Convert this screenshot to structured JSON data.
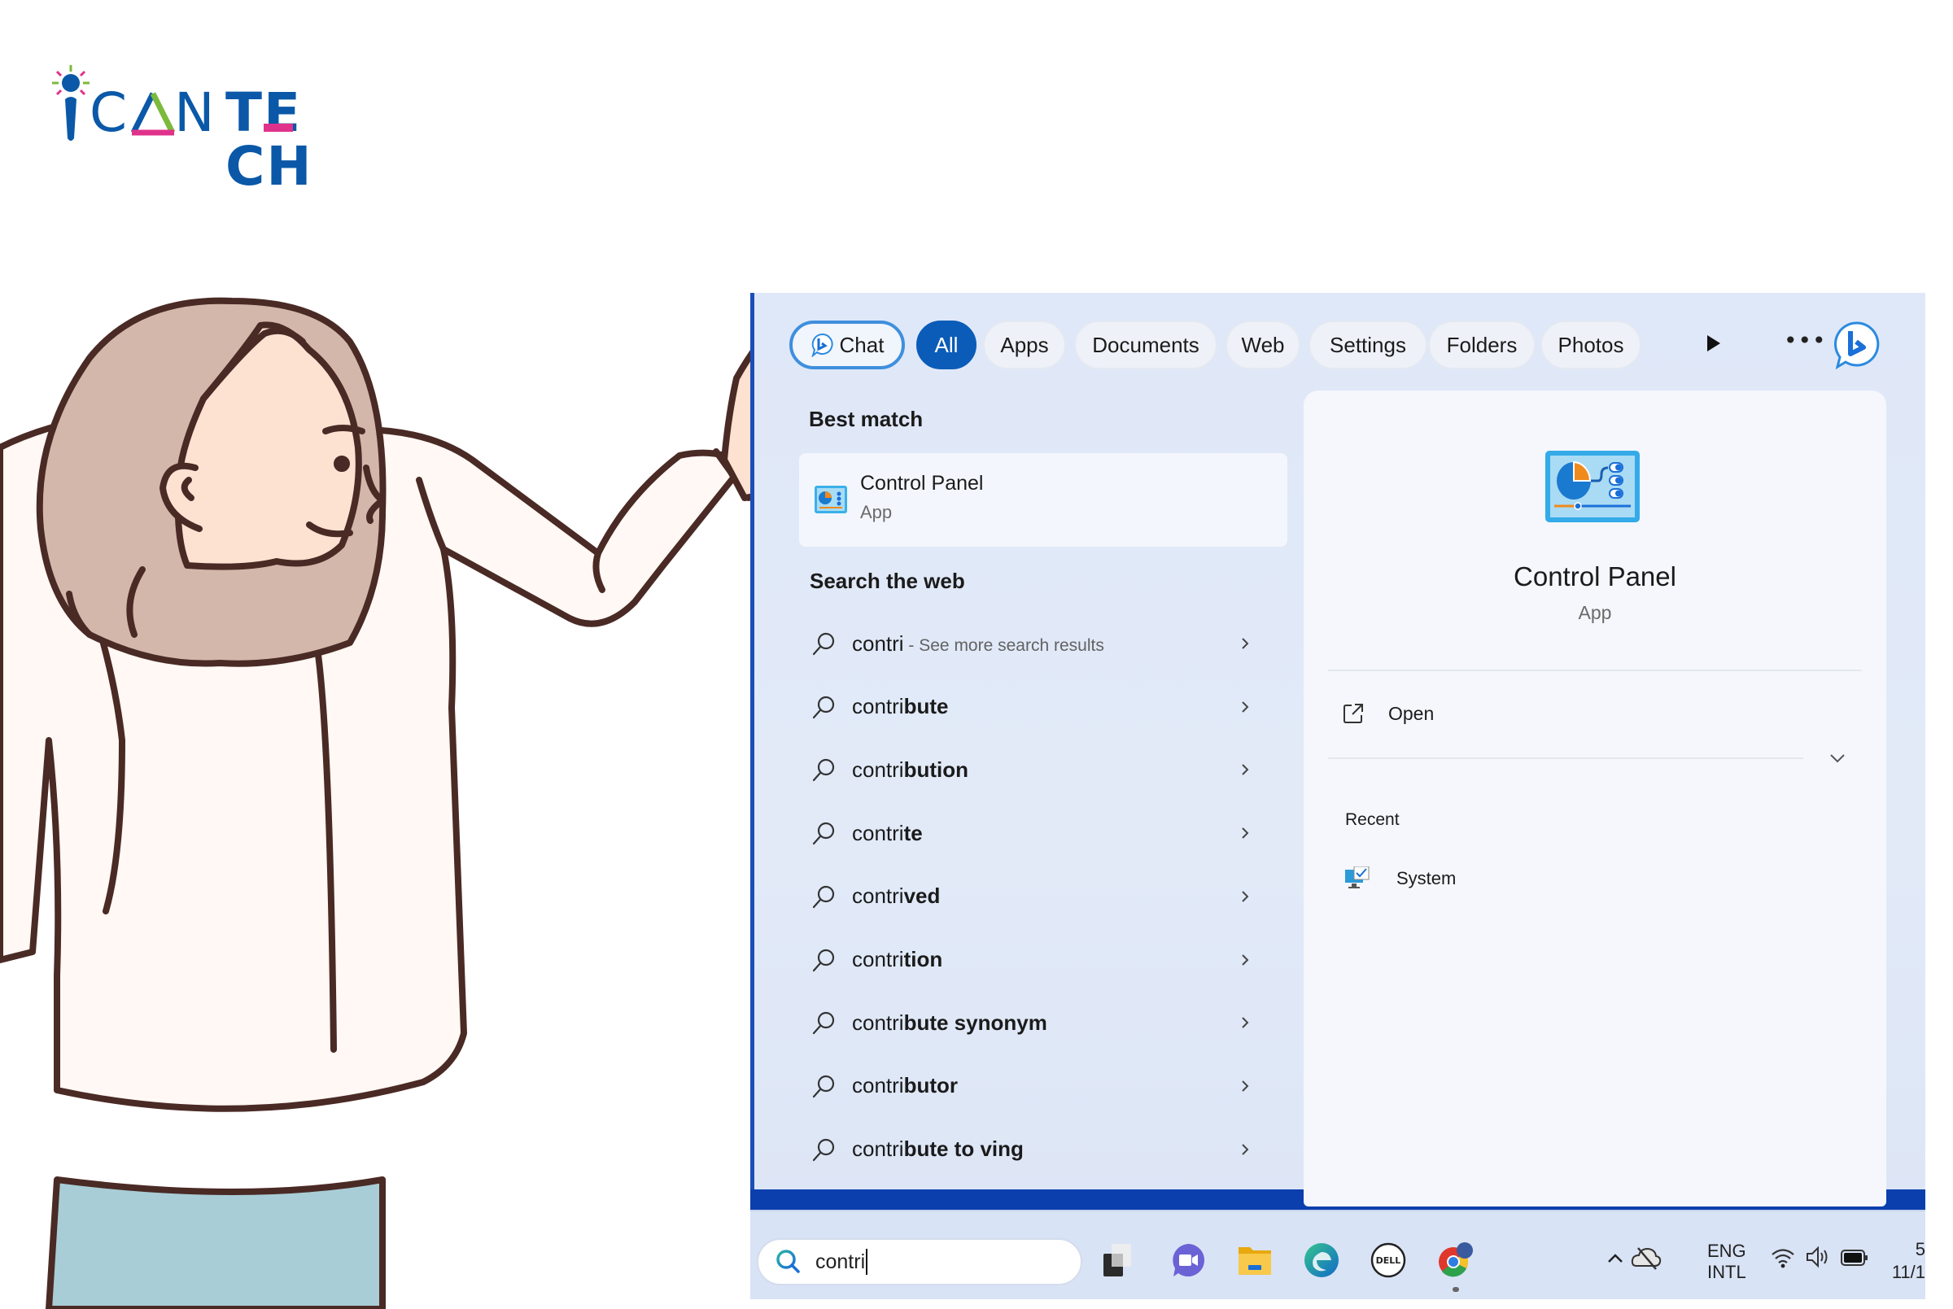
{
  "brand": {
    "logo_text_part1": "CAN",
    "logo_text_part2": "TECH",
    "colors": {
      "blue": "#0b58a8",
      "pink": "#e0328a",
      "green": "#7cba3c"
    }
  },
  "search_panel": {
    "tabs": [
      {
        "label": "Chat",
        "icon": "bing-chat-icon",
        "state": "outlined"
      },
      {
        "label": "All",
        "state": "active"
      },
      {
        "label": "Apps"
      },
      {
        "label": "Documents"
      },
      {
        "label": "Web"
      },
      {
        "label": "Settings"
      },
      {
        "label": "Folders"
      },
      {
        "label": "Photos"
      }
    ],
    "more_tabs_icon": "play-icon",
    "overflow_icon": "more-horizontal-icon",
    "bing_icon": "bing-icon",
    "best_match": {
      "section_label": "Best match",
      "title": "Control Panel",
      "subtitle": "App",
      "icon": "control-panel-icon"
    },
    "web": {
      "section_label": "Search the web",
      "items": [
        {
          "prefix": "contri",
          "completion": "",
          "suffix": " - See more search results"
        },
        {
          "prefix": "contri",
          "completion": "bute",
          "suffix": ""
        },
        {
          "prefix": "contri",
          "completion": "bution",
          "suffix": ""
        },
        {
          "prefix": "contri",
          "completion": "te",
          "suffix": ""
        },
        {
          "prefix": "contri",
          "completion": "ved",
          "suffix": ""
        },
        {
          "prefix": "contri",
          "completion": "tion",
          "suffix": ""
        },
        {
          "prefix": "contri",
          "completion": "bute synonym",
          "suffix": ""
        },
        {
          "prefix": "contri",
          "completion": "butor",
          "suffix": ""
        },
        {
          "prefix": "contri",
          "completion": "bute to ving",
          "suffix": ""
        }
      ]
    },
    "detail": {
      "title": "Control Panel",
      "subtitle": "App",
      "actions": [
        {
          "label": "Open",
          "icon": "open-external-icon"
        }
      ],
      "recent_label": "Recent",
      "recent_items": [
        {
          "label": "System",
          "icon": "system-icon"
        }
      ]
    },
    "accent": "#0b5cb8"
  },
  "taskbar": {
    "search_value": "contri",
    "pinned": [
      "task-view-icon",
      "teams-meet-icon",
      "file-explorer-icon",
      "edge-icon",
      "dell-icon",
      "chrome-icon"
    ],
    "tray": {
      "lang_line1": "ENG",
      "lang_line2": "INTL",
      "time_partial": "5",
      "date_partial": "11/1"
    }
  }
}
